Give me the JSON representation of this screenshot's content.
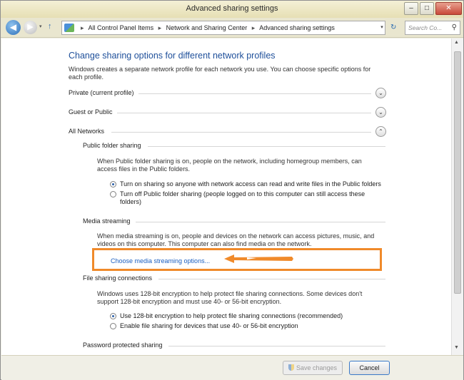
{
  "window": {
    "title": "Advanced sharing settings"
  },
  "titlebar": {
    "min_glyph": "–",
    "max_glyph": "□",
    "close_glyph": "✕"
  },
  "nav": {
    "back_glyph": "◀",
    "forward_glyph": "▶",
    "history_glyph": "▾",
    "up_glyph": "↑",
    "breadcrumb": [
      "All Control Panel Items",
      "Network and Sharing Center",
      "Advanced sharing settings"
    ],
    "breadcrumb_sep": "▸",
    "dropdown_glyph": "▾",
    "refresh_glyph": "↻",
    "search_placeholder": "Search Co...",
    "search_glyph": "⚲"
  },
  "main": {
    "heading": "Change sharing options for different network profiles",
    "intro": "Windows creates a separate network profile for each network you use. You can choose specific options for each profile.",
    "profiles": [
      {
        "label": "Private (current profile)",
        "chevron": "⌄",
        "expanded": false
      },
      {
        "label": "Guest or Public",
        "chevron": "⌄",
        "expanded": false
      },
      {
        "label": "All Networks",
        "chevron": "⌃",
        "expanded": true
      }
    ],
    "public_folder": {
      "title": "Public folder sharing",
      "description": "When Public folder sharing is on, people on the network, including homegroup members, can access files in the Public folders.",
      "options": [
        {
          "label": "Turn on sharing so anyone with network access can read and write files in the Public folders",
          "selected": true
        },
        {
          "label": "Turn off Public folder sharing (people logged on to this computer can still access these folders)",
          "selected": false
        }
      ]
    },
    "media_streaming": {
      "title": "Media streaming",
      "description": "When media streaming is on, people and devices on the network can access pictures, music, and videos on this computer. This computer can also find media on the network.",
      "link": "Choose media streaming options..."
    },
    "file_sharing": {
      "title": "File sharing connections",
      "description": "Windows uses 128-bit encryption to help protect file sharing connections. Some devices don't support 128-bit encryption and must use 40- or 56-bit encryption.",
      "options": [
        {
          "label": "Use 128-bit encryption to help protect file sharing connections (recommended)",
          "selected": true
        },
        {
          "label": "Enable file sharing for devices that use 40- or 56-bit encryption",
          "selected": false
        }
      ]
    },
    "password_sharing": {
      "title": "Password protected sharing"
    }
  },
  "scroll": {
    "up_glyph": "▲",
    "down_glyph": "▼"
  },
  "footer": {
    "save_label": "Save changes",
    "cancel_label": "Cancel"
  },
  "colors": {
    "heading": "#1e4f9a",
    "link": "#1b5fc1",
    "highlight": "#f08a2a"
  }
}
